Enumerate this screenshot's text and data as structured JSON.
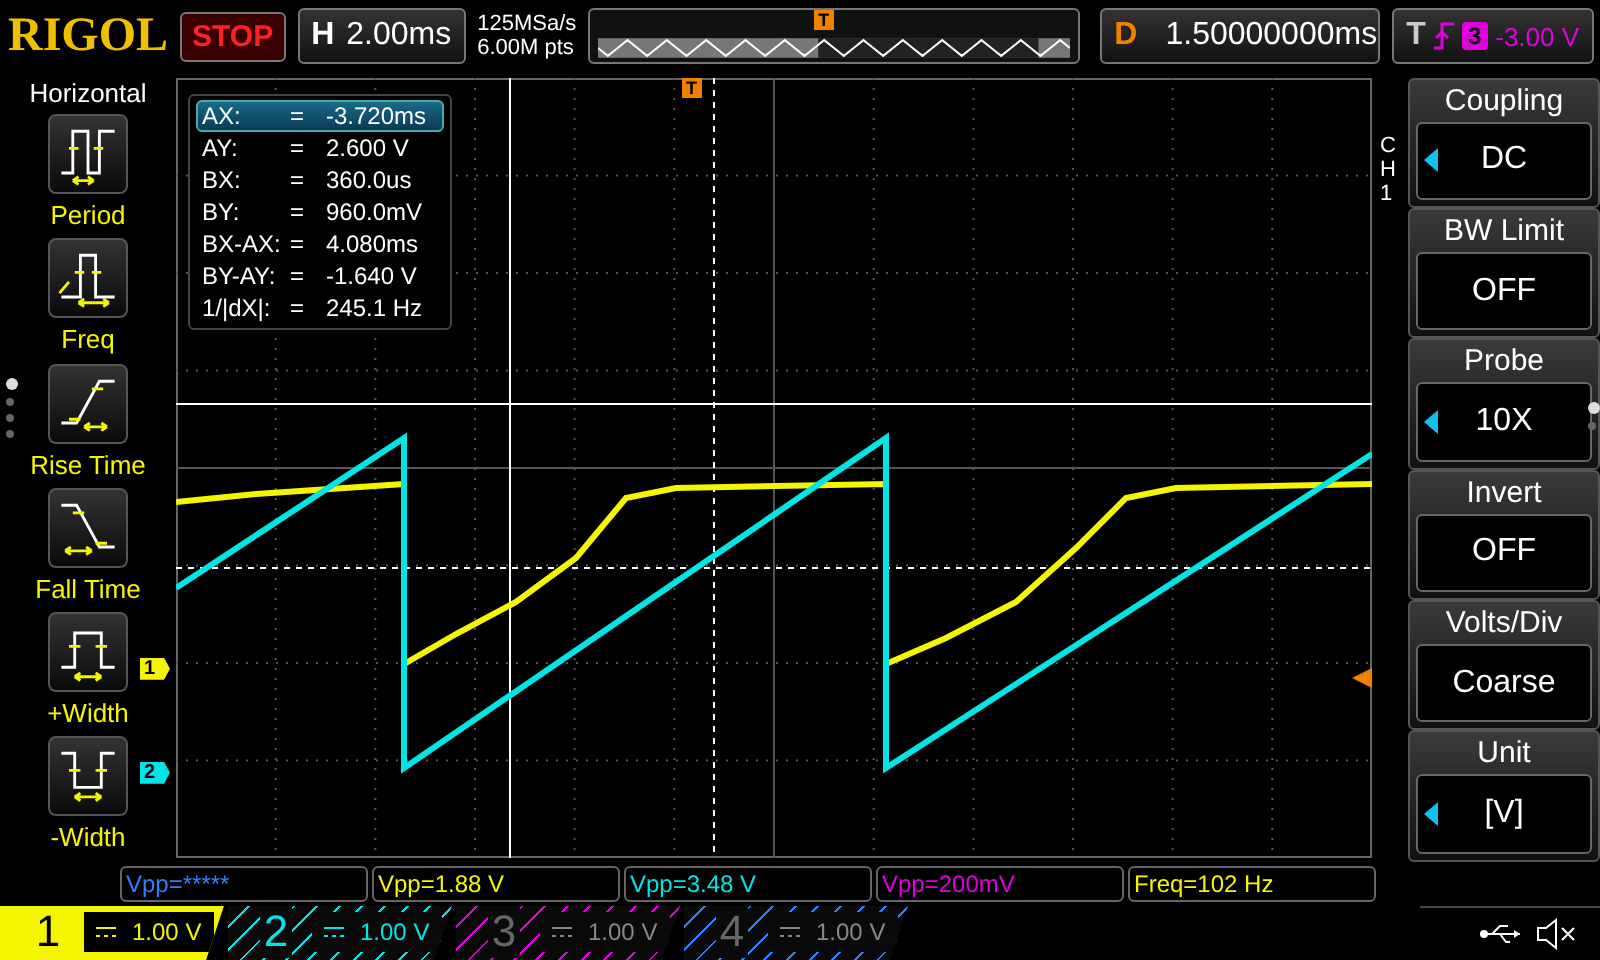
{
  "header": {
    "logo": "RIGOL",
    "run_state": "STOP",
    "timebase": {
      "label": "H",
      "value": "2.00ms"
    },
    "sample_rate": "125MSa/s",
    "memory_depth": "6.00M pts",
    "overview_marker": "T",
    "delay": {
      "label": "D",
      "value": "1.50000000ms"
    },
    "trigger": {
      "label": "T",
      "source": "3",
      "level": "-3.00 V"
    }
  },
  "left_menu": {
    "title": "Horizontal",
    "items": [
      {
        "kind": "period",
        "label": "Period"
      },
      {
        "kind": "freq",
        "label": "Freq"
      },
      {
        "kind": "rise",
        "label": "Rise Time"
      },
      {
        "kind": "fall",
        "label": "Fall Time"
      },
      {
        "kind": "pwidth",
        "label": "+Width"
      },
      {
        "kind": "nwidth",
        "label": "-Width"
      }
    ],
    "pages": [
      {
        "selected": true
      },
      {
        "selected": false
      },
      {
        "selected": false
      },
      {
        "selected": false
      }
    ]
  },
  "grid": {
    "trigger_position_marker": "T",
    "channel_markers": [
      {
        "label": "1",
        "color": "#f5f500"
      },
      {
        "label": "2",
        "color": "#00e5e5"
      }
    ]
  },
  "cursor_readout": [
    {
      "label": "AX:",
      "sign": "=",
      "value": "-3.720ms",
      "selected": true
    },
    {
      "label": "AY:",
      "sign": "=",
      "value": "2.600 V",
      "selected": false
    },
    {
      "label": "BX:",
      "sign": "=",
      "value": "360.0us",
      "selected": false
    },
    {
      "label": "BY:",
      "sign": "=",
      "value": "960.0mV",
      "selected": false
    },
    {
      "label": "BX-AX:",
      "sign": "=",
      "value": "4.080ms",
      "selected": false
    },
    {
      "label": "BY-AY:",
      "sign": "=",
      "value": "-1.640 V",
      "selected": false
    },
    {
      "label": "1/|dX|:",
      "sign": "=",
      "value": "245.1 Hz",
      "selected": false
    }
  ],
  "right_menu": {
    "channel": "CH1",
    "items": [
      {
        "title": "Coupling",
        "value": "DC",
        "adjustable": true
      },
      {
        "title": "BW Limit",
        "value": "OFF",
        "adjustable": false
      },
      {
        "title": "Probe",
        "value": "10X",
        "adjustable": true
      },
      {
        "title": "Invert",
        "value": "OFF",
        "adjustable": false
      },
      {
        "title": "Volts/Div",
        "value": "Coarse",
        "adjustable": false
      },
      {
        "title": "Unit",
        "value": "[V]",
        "adjustable": true
      }
    ],
    "pages": [
      {
        "selected": true
      },
      {
        "selected": false
      }
    ]
  },
  "measurements": [
    {
      "text": "Vpp=*****",
      "color": "#2f7fff"
    },
    {
      "text": "Vpp=1.88 V",
      "color": "#f5f500"
    },
    {
      "text": "Vpp=3.48 V",
      "color": "#00e5e5"
    },
    {
      "text": "Vpp=200mV",
      "color": "#e000e0"
    },
    {
      "text": "Freq=102 Hz",
      "color": "#f5f500"
    }
  ],
  "channels": [
    {
      "number": "1",
      "scale": "1.00 V",
      "active": true,
      "color": "#f5f500"
    },
    {
      "number": "2",
      "scale": "1.00 V",
      "active": true,
      "color": "#00e5e5"
    },
    {
      "number": "3",
      "scale": "1.00 V",
      "active": false,
      "color": "#e000e0"
    },
    {
      "number": "4",
      "scale": "1.00 V",
      "active": false,
      "color": "#2f7fff"
    }
  ]
}
